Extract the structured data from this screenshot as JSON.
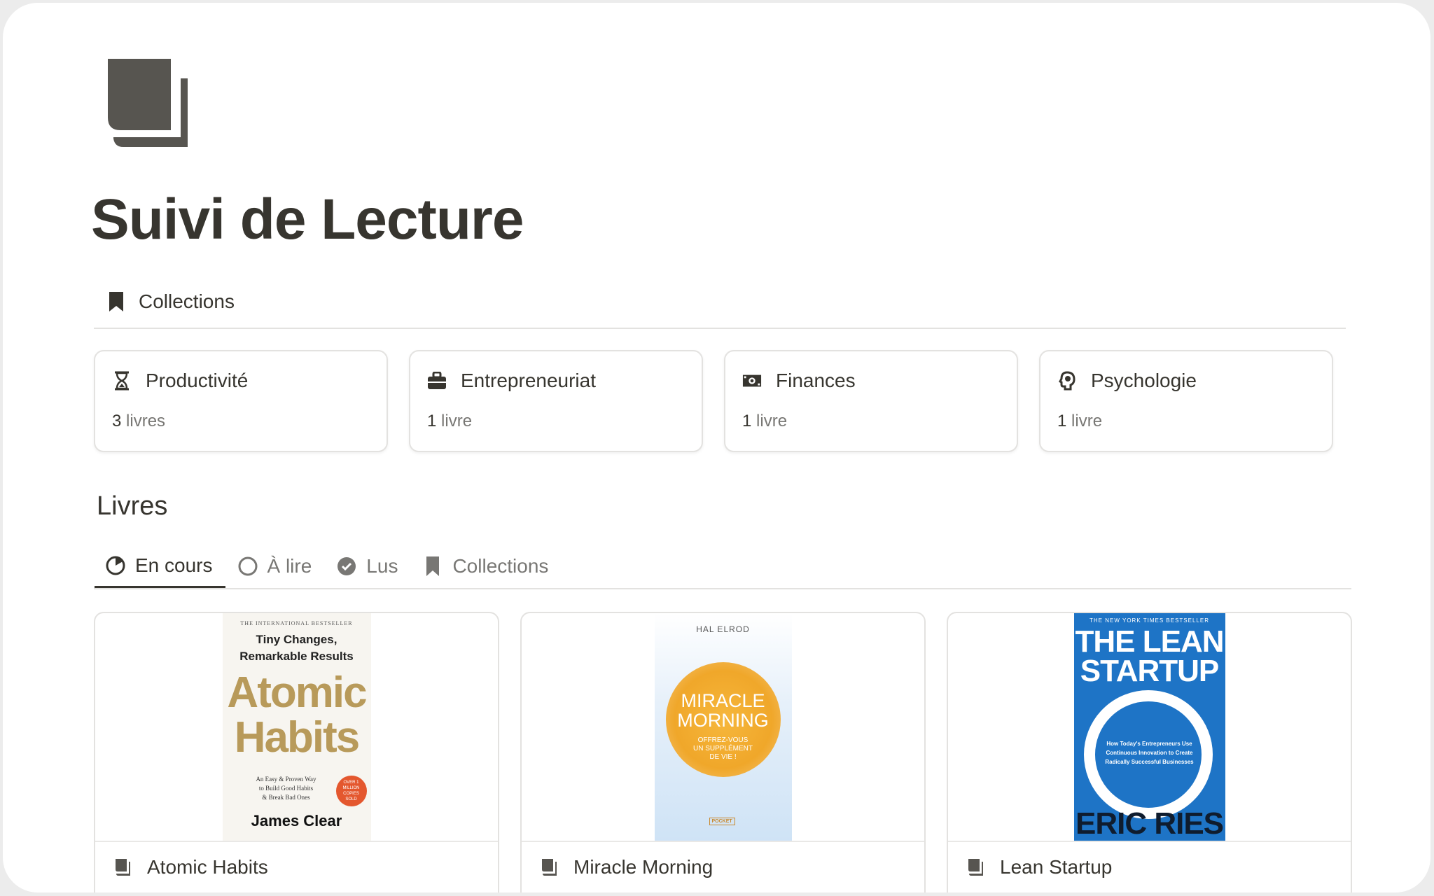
{
  "page": {
    "title": "Suivi de Lecture",
    "icon": "book-stack-icon"
  },
  "collections_section": {
    "label": "Collections",
    "icon": "bookmark-icon"
  },
  "collections": [
    {
      "name": "Productivité",
      "icon": "hourglass-icon",
      "count": "3",
      "unit": "livres"
    },
    {
      "name": "Entrepreneuriat",
      "icon": "briefcase-icon",
      "count": "1",
      "unit": "livre"
    },
    {
      "name": "Finances",
      "icon": "banknote-icon",
      "count": "1",
      "unit": "livre"
    },
    {
      "name": "Psychologie",
      "icon": "brain-head-icon",
      "count": "1",
      "unit": "livre"
    }
  ],
  "books_db": {
    "title": "Livres",
    "tabs": [
      {
        "label": "En cours",
        "icon": "progress-circle-icon",
        "active": true
      },
      {
        "label": "À lire",
        "icon": "empty-circle-icon",
        "active": false
      },
      {
        "label": "Lus",
        "icon": "check-circle-icon",
        "active": false
      },
      {
        "label": "Collections",
        "icon": "bookmark-icon",
        "active": false
      }
    ]
  },
  "books": [
    {
      "title": "Atomic Habits",
      "icon": "book-icon",
      "cover": {
        "top": "THE INTERNATIONAL BESTSELLER",
        "tagline1": "Tiny Changes,",
        "tagline2": "Remarkable Results",
        "title1": "Atomic",
        "title2": "Habits",
        "sub1": "An Easy & Proven Way",
        "sub2": "to Build Good Habits",
        "sub3": "& Break Bad Ones",
        "badge": "OVER 1 MILLION COPIES SOLD",
        "author": "James Clear"
      }
    },
    {
      "title": "Miracle Morning",
      "icon": "book-icon",
      "cover": {
        "author": "HAL ELROD",
        "title1": "MIRACLE",
        "title2": "MORNING",
        "sub1": "OFFREZ-VOUS",
        "sub2": "UN SUPPLÉMENT",
        "sub3": "DE VIE !",
        "publisher": "POCKET"
      }
    },
    {
      "title": "Lean Startup",
      "icon": "book-icon",
      "cover": {
        "top": "THE NEW YORK TIMES BESTSELLER",
        "title1": "THE LEAN",
        "title2": "STARTUP",
        "sub1": "How Today's Entrepreneurs Use",
        "sub2": "Continuous Innovation to Create",
        "sub3": "Radically Successful Businesses",
        "author": "ERIC RIES"
      }
    }
  ],
  "colors": {
    "text": "#37352f",
    "muted": "#787774",
    "border": "#e3e2e0",
    "lean_blue": "#1e74c6",
    "atomic_gold": "#b89a5a",
    "miracle_orange": "#f0a72a"
  }
}
